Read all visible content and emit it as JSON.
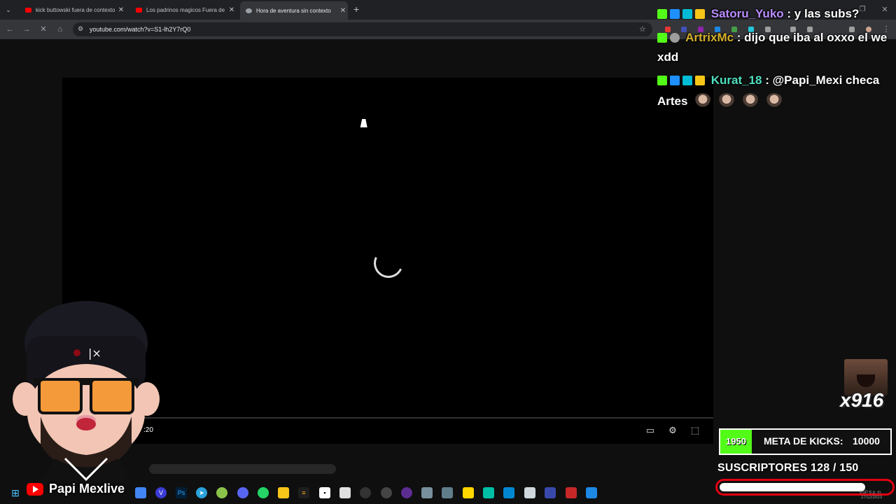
{
  "browser": {
    "tabs": [
      {
        "title": "kick buttowski fuera de contexto",
        "favicon": "youtube-icon",
        "active": false
      },
      {
        "title": "Los padrinos magicos Fuera de",
        "favicon": "youtube-icon",
        "active": false
      },
      {
        "title": "Hora de aventura sin contexto",
        "favicon": "loading-icon",
        "active": true
      }
    ],
    "url": "youtube.com/watch?v=S1-lh2Y7rQ0"
  },
  "player": {
    "time": ":20",
    "state": "loading"
  },
  "chat": [
    {
      "username": "Satoru_Yuko",
      "username_color": "#b98cff",
      "message": " : y las subs?"
    },
    {
      "username": "ArtrixMc",
      "username_color": "#d4b02b",
      "message": " : dijo que iba al oxxo el we",
      "continuation": "xdd"
    },
    {
      "username": "Kurat_18",
      "username_color": "#4fe0c0",
      "message": " : @Papi_Mexi checa",
      "continuation": "Artes"
    }
  ],
  "widgets": {
    "multiplier": "x916",
    "kicks_current": "1950",
    "kicks_label": "META DE KICKS:",
    "kicks_goal": "10000",
    "subs_label": "SUSCRIPTORES  128  / 150",
    "subs_current": 128,
    "subs_goal": 150,
    "accent_green": "#53fc18",
    "accent_red": "#e00012"
  },
  "overlay": {
    "streamer_name": "Papi Mexlive"
  },
  "taskbar": {
    "lang": "ESP",
    "date": "27/12/2023",
    "time": "6 p. m."
  }
}
